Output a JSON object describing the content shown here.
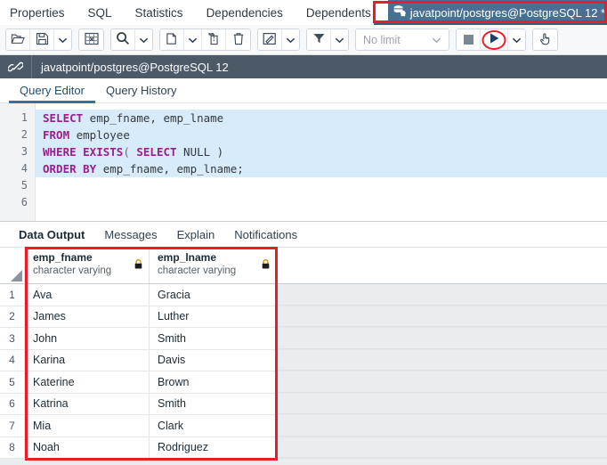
{
  "object_tabs": [
    {
      "label": "Properties"
    },
    {
      "label": "SQL"
    },
    {
      "label": "Statistics"
    },
    {
      "label": "Dependencies"
    },
    {
      "label": "Dependents"
    }
  ],
  "connection_tab": {
    "label": "javatpoint/postgres@PostgreSQL 12 *",
    "icon": "database-server-icon",
    "background": "#4a6e94",
    "highlight_color": "#ed1c24"
  },
  "toolbar": {
    "groups": [
      {
        "buttons": [
          {
            "name": "open-file-button",
            "icon": "open-folder-icon",
            "title": "Open File"
          },
          {
            "name": "save-file-button",
            "icon": "floppy-save-icon",
            "title": "Save File"
          },
          {
            "name": "save-dropdown-button",
            "icon": "chevron-down-icon",
            "title": "Save options"
          }
        ]
      },
      {
        "buttons": [
          {
            "name": "edit-grid-button",
            "icon": "grid-edit-icon",
            "title": "Edit grid"
          }
        ]
      },
      {
        "buttons": [
          {
            "name": "find-button",
            "icon": "magnifier-icon",
            "title": "Find"
          },
          {
            "name": "find-dropdown-button",
            "icon": "chevron-down-icon",
            "title": "Find options"
          }
        ]
      },
      {
        "buttons": [
          {
            "name": "copy-button",
            "icon": "copy-icon",
            "title": "Copy"
          },
          {
            "name": "copy-dropdown-button",
            "icon": "chevron-down-icon",
            "title": "Copy options"
          },
          {
            "name": "paste-button",
            "icon": "paste-icon",
            "title": "Paste"
          },
          {
            "name": "delete-button",
            "icon": "trash-icon",
            "title": "Delete"
          }
        ]
      },
      {
        "buttons": [
          {
            "name": "edit-button",
            "icon": "pencil-square-icon",
            "title": "Edit"
          },
          {
            "name": "edit-dropdown-button",
            "icon": "chevron-down-icon",
            "title": "Edit options"
          }
        ]
      },
      {
        "buttons": [
          {
            "name": "filter-button",
            "icon": "funnel-icon",
            "title": "Filter"
          },
          {
            "name": "filter-dropdown-button",
            "icon": "chevron-down-icon",
            "title": "Filter options"
          }
        ]
      }
    ],
    "row_limit": {
      "name": "row-limit-select",
      "value": "No limit",
      "icon": "chevron-down-icon"
    },
    "execute_group": [
      {
        "name": "stop-button",
        "icon": "stop-square-icon",
        "title": "Stop"
      },
      {
        "name": "execute-button",
        "icon": "play-triangle-icon",
        "title": "Execute/Refresh",
        "annotated": true
      },
      {
        "name": "execute-dropdown-button",
        "icon": "chevron-down-icon",
        "title": "Execute options"
      }
    ],
    "trailing": [
      {
        "name": "macros-button",
        "icon": "hand-pointer-icon",
        "title": "Macros"
      }
    ]
  },
  "connection_bar": {
    "icon": "chain-link-icon",
    "label": "javatpoint/postgres@PostgreSQL 12"
  },
  "editor_tabs": [
    {
      "label": "Query Editor",
      "active": true
    },
    {
      "label": "Query History",
      "active": false
    }
  ],
  "sql_editor": {
    "line_numbers": [
      "1",
      "2",
      "3",
      "4",
      "5",
      "6"
    ],
    "lines": [
      {
        "selected": true,
        "tokens": [
          {
            "t": "SELECT",
            "c": "kw"
          },
          {
            "t": " emp_fname, emp_lname",
            "c": "ident"
          }
        ]
      },
      {
        "selected": true,
        "tokens": [
          {
            "t": "FROM",
            "c": "kw"
          },
          {
            "t": " employee",
            "c": "ident"
          }
        ]
      },
      {
        "selected": true,
        "tokens": [
          {
            "t": "WHERE EXISTS",
            "c": "kw"
          },
          {
            "t": "( ",
            "c": "punct"
          },
          {
            "t": "SELECT",
            "c": "kw"
          },
          {
            "t": " NULL )",
            "c": "ident"
          }
        ]
      },
      {
        "selected": true,
        "tokens": [
          {
            "t": "ORDER BY",
            "c": "kw"
          },
          {
            "t": " emp_fname, emp_lname;",
            "c": "ident"
          }
        ]
      },
      {
        "selected": false,
        "tokens": []
      },
      {
        "selected": false,
        "tokens": []
      }
    ],
    "selection_color": "#d8ebfa"
  },
  "result_tabs": [
    {
      "label": "Data Output",
      "active": true
    },
    {
      "label": "Messages",
      "active": false
    },
    {
      "label": "Explain",
      "active": false
    },
    {
      "label": "Notifications",
      "active": false
    }
  ],
  "result_grid": {
    "columns": [
      {
        "name": "emp_fname",
        "type": "character varying",
        "lock_icon": "lock-icon"
      },
      {
        "name": "emp_lname",
        "type": "character varying",
        "lock_icon": "lock-icon"
      }
    ],
    "rows": [
      {
        "n": "1",
        "emp_fname": "Ava",
        "emp_lname": "Gracia"
      },
      {
        "n": "2",
        "emp_fname": "James",
        "emp_lname": "Luther"
      },
      {
        "n": "3",
        "emp_fname": "John",
        "emp_lname": "Smith"
      },
      {
        "n": "4",
        "emp_fname": "Karina",
        "emp_lname": "Davis"
      },
      {
        "n": "5",
        "emp_fname": "Katerine",
        "emp_lname": "Brown"
      },
      {
        "n": "6",
        "emp_fname": "Katrina",
        "emp_lname": "Smith"
      },
      {
        "n": "7",
        "emp_fname": "Mia",
        "emp_lname": "Clark"
      },
      {
        "n": "8",
        "emp_fname": "Noah",
        "emp_lname": "Rodriguez"
      }
    ]
  },
  "annotations": [
    {
      "name": "connection-tab-highlight",
      "color": "#ed1c24"
    },
    {
      "name": "result-grid-highlight",
      "color": "#ed1c24"
    },
    {
      "name": "execute-button-highlight",
      "color": "#ed1c24"
    }
  ]
}
